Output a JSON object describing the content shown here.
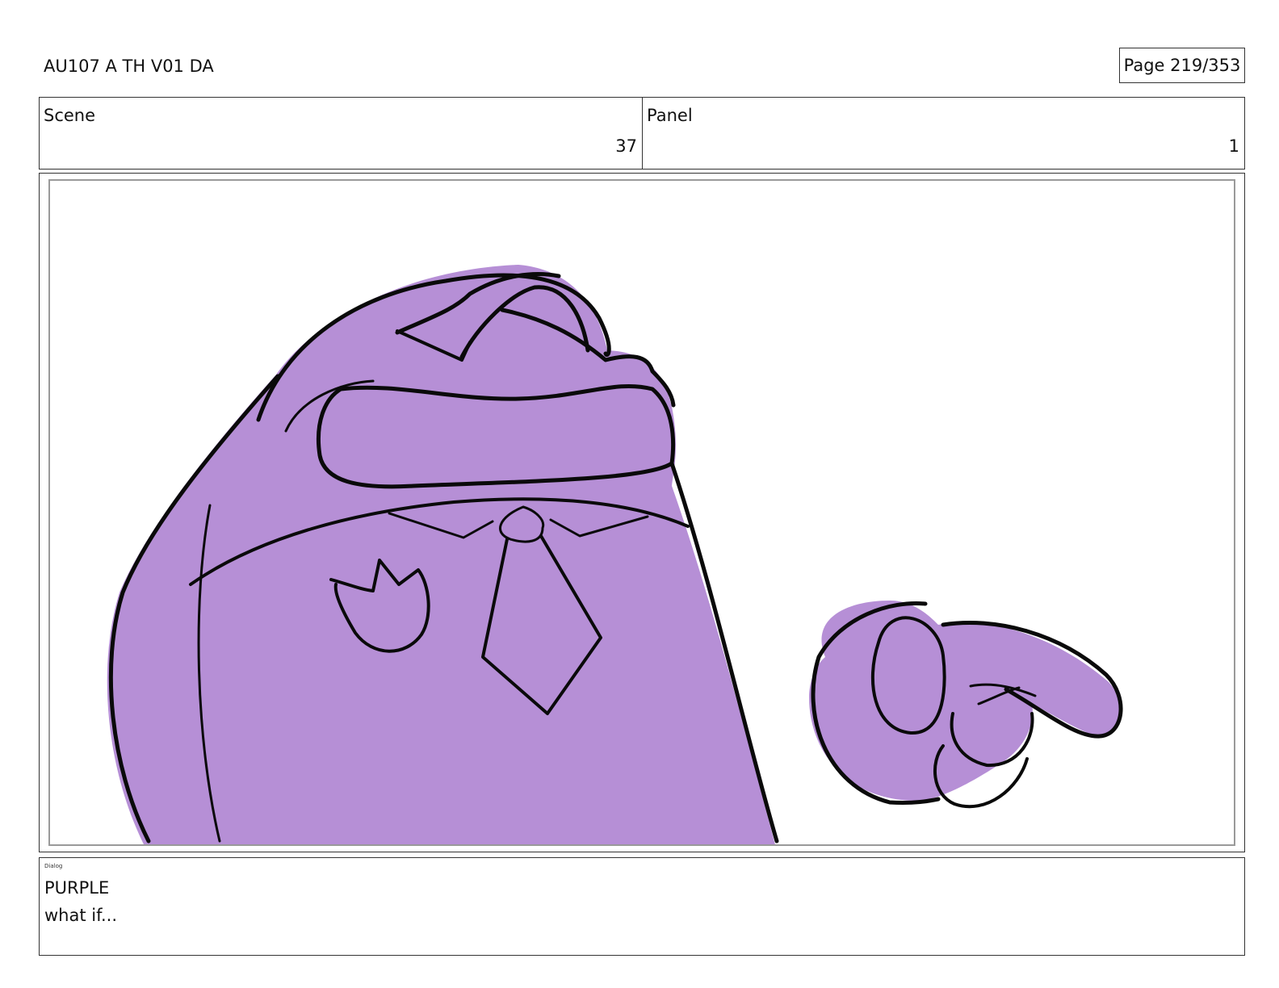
{
  "header": {
    "title": "AU107 A TH V01 DA",
    "page": "Page 219/353"
  },
  "scene": {
    "label": "Scene",
    "value": "37"
  },
  "panel": {
    "label": "Panel",
    "value": "1"
  },
  "artwork": {
    "fill_color": "#b68fd6",
    "line_color": "#0a0a0a"
  },
  "dialog": {
    "label": "Dialog",
    "speaker": "PURPLE",
    "line": "what if..."
  }
}
